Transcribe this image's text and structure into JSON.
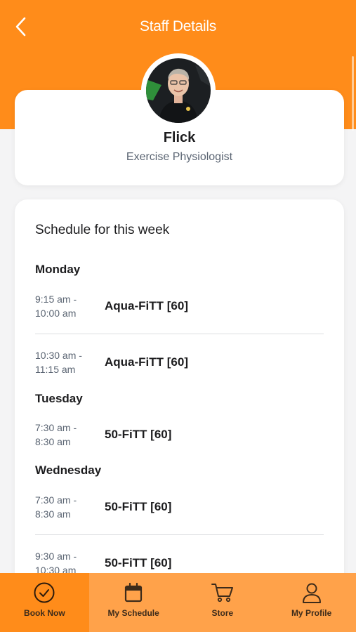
{
  "header": {
    "title": "Staff Details",
    "back_icon": "chevron-left-icon"
  },
  "staff": {
    "name": "Flick",
    "role": "Exercise Physiologist"
  },
  "schedule": {
    "title": "Schedule for this week",
    "days": [
      {
        "day": "Monday",
        "sessions": [
          {
            "time_start": "9:15 am -",
            "time_end": "10:00 am",
            "class": "Aqua-FiTT [60]"
          },
          {
            "time_start": "10:30 am -",
            "time_end": "11:15 am",
            "class": "Aqua-FiTT [60]"
          }
        ]
      },
      {
        "day": "Tuesday",
        "sessions": [
          {
            "time_start": "7:30 am -",
            "time_end": "8:30 am",
            "class": "50-FiTT [60]"
          }
        ]
      },
      {
        "day": "Wednesday",
        "sessions": [
          {
            "time_start": "7:30 am -",
            "time_end": "8:30 am",
            "class": "50-FiTT [60]"
          },
          {
            "time_start": "9:30 am -",
            "time_end": "10:30 am",
            "class": "50-FiTT [60]"
          }
        ]
      }
    ]
  },
  "nav": {
    "items": [
      {
        "label": "Book Now",
        "icon": "check-circle-icon",
        "active": true
      },
      {
        "label": "My Schedule",
        "icon": "calendar-icon",
        "active": false
      },
      {
        "label": "Store",
        "icon": "cart-icon",
        "active": false
      },
      {
        "label": "My Profile",
        "icon": "user-icon",
        "active": false
      }
    ]
  },
  "colors": {
    "brand_orange": "#ff8c1a",
    "nav_bg": "#ffa24a",
    "page_bg": "#f4f4f5"
  }
}
